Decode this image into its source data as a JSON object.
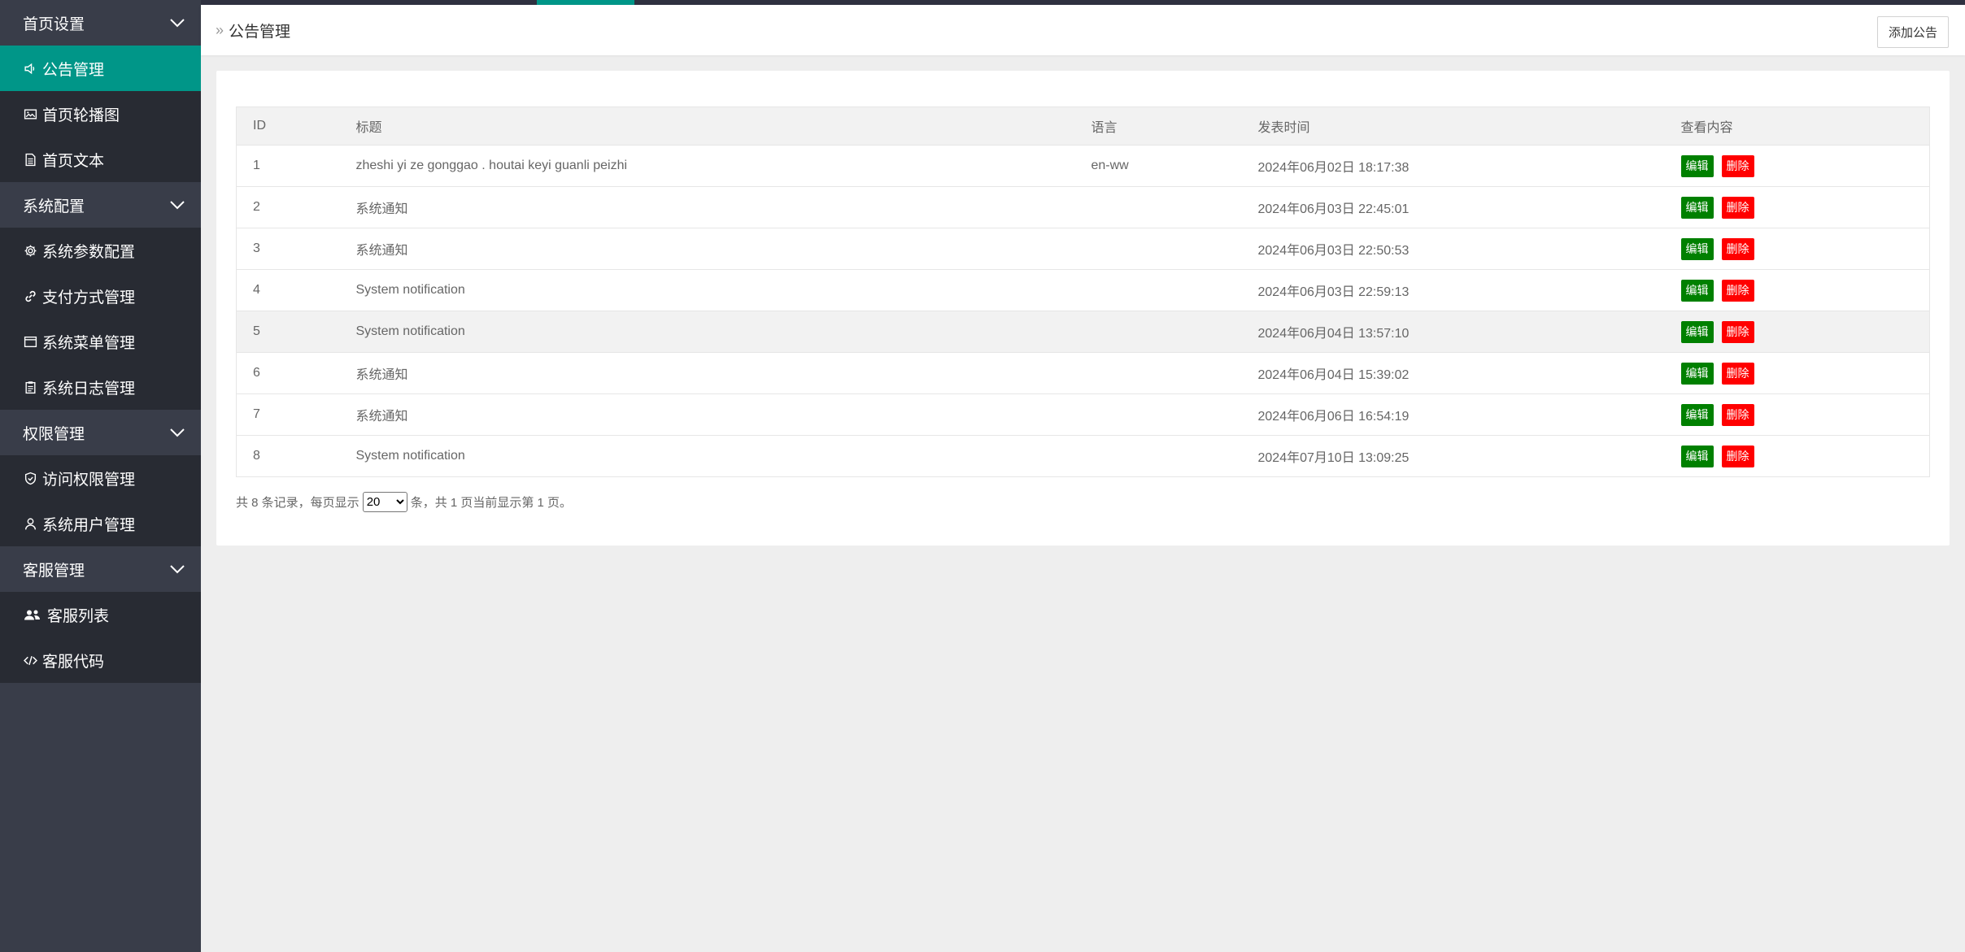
{
  "colors": {
    "sidebar_bg": "#393d49",
    "submenu_bg": "#282b33",
    "active_bg": "#009688",
    "edit_btn": "#008000",
    "delete_btn": "#ff0000"
  },
  "sidebar": {
    "groups": [
      {
        "label": "首页设置",
        "items": [
          {
            "label": "公告管理",
            "icon": "speaker-icon",
            "active": true
          },
          {
            "label": "首页轮播图",
            "icon": "image-icon"
          },
          {
            "label": "首页文本",
            "icon": "document-icon"
          }
        ]
      },
      {
        "label": "系统配置",
        "items": [
          {
            "label": "系统参数配置",
            "icon": "gear-icon"
          },
          {
            "label": "支付方式管理",
            "icon": "link-icon"
          },
          {
            "label": "系统菜单管理",
            "icon": "window-icon"
          },
          {
            "label": "系统日志管理",
            "icon": "clipboard-icon"
          }
        ]
      },
      {
        "label": "权限管理",
        "items": [
          {
            "label": "访问权限管理",
            "icon": "shield-icon"
          },
          {
            "label": "系统用户管理",
            "icon": "user-icon"
          }
        ]
      },
      {
        "label": "客服管理",
        "items": [
          {
            "label": "客服列表",
            "icon": "users-icon"
          },
          {
            "label": "客服代码",
            "icon": "code-icon"
          }
        ]
      }
    ]
  },
  "header": {
    "breadcrumb": "公告管理",
    "add_button": "添加公告"
  },
  "table": {
    "columns": {
      "id": "ID",
      "title": "标题",
      "lang": "语言",
      "time": "发表时间",
      "actions": "查看内容"
    },
    "edit_label": "编辑",
    "delete_label": "删除",
    "rows": [
      {
        "id": "1",
        "title": "zheshi yi ze gonggao . houtai keyi guanli peizhi",
        "lang": "en-ww",
        "time": "2024年06月02日 18:17:38"
      },
      {
        "id": "2",
        "title": "系统通知",
        "lang": "",
        "time": "2024年06月03日 22:45:01"
      },
      {
        "id": "3",
        "title": "系统通知",
        "lang": "",
        "time": "2024年06月03日 22:50:53"
      },
      {
        "id": "4",
        "title": "System notification",
        "lang": "",
        "time": "2024年06月03日 22:59:13"
      },
      {
        "id": "5",
        "title": "System notification",
        "lang": "",
        "time": "2024年06月04日 13:57:10",
        "hover": true
      },
      {
        "id": "6",
        "title": "系统通知",
        "lang": "",
        "time": "2024年06月04日 15:39:02"
      },
      {
        "id": "7",
        "title": "系统通知",
        "lang": "",
        "time": "2024年06月06日 16:54:19"
      },
      {
        "id": "8",
        "title": "System notification",
        "lang": "",
        "time": "2024年07月10日 13:09:25"
      }
    ]
  },
  "pager": {
    "prefix": "共 8 条记录，每页显示",
    "page_size": "20",
    "suffix": "条，共 1 页当前显示第 1 页。"
  }
}
